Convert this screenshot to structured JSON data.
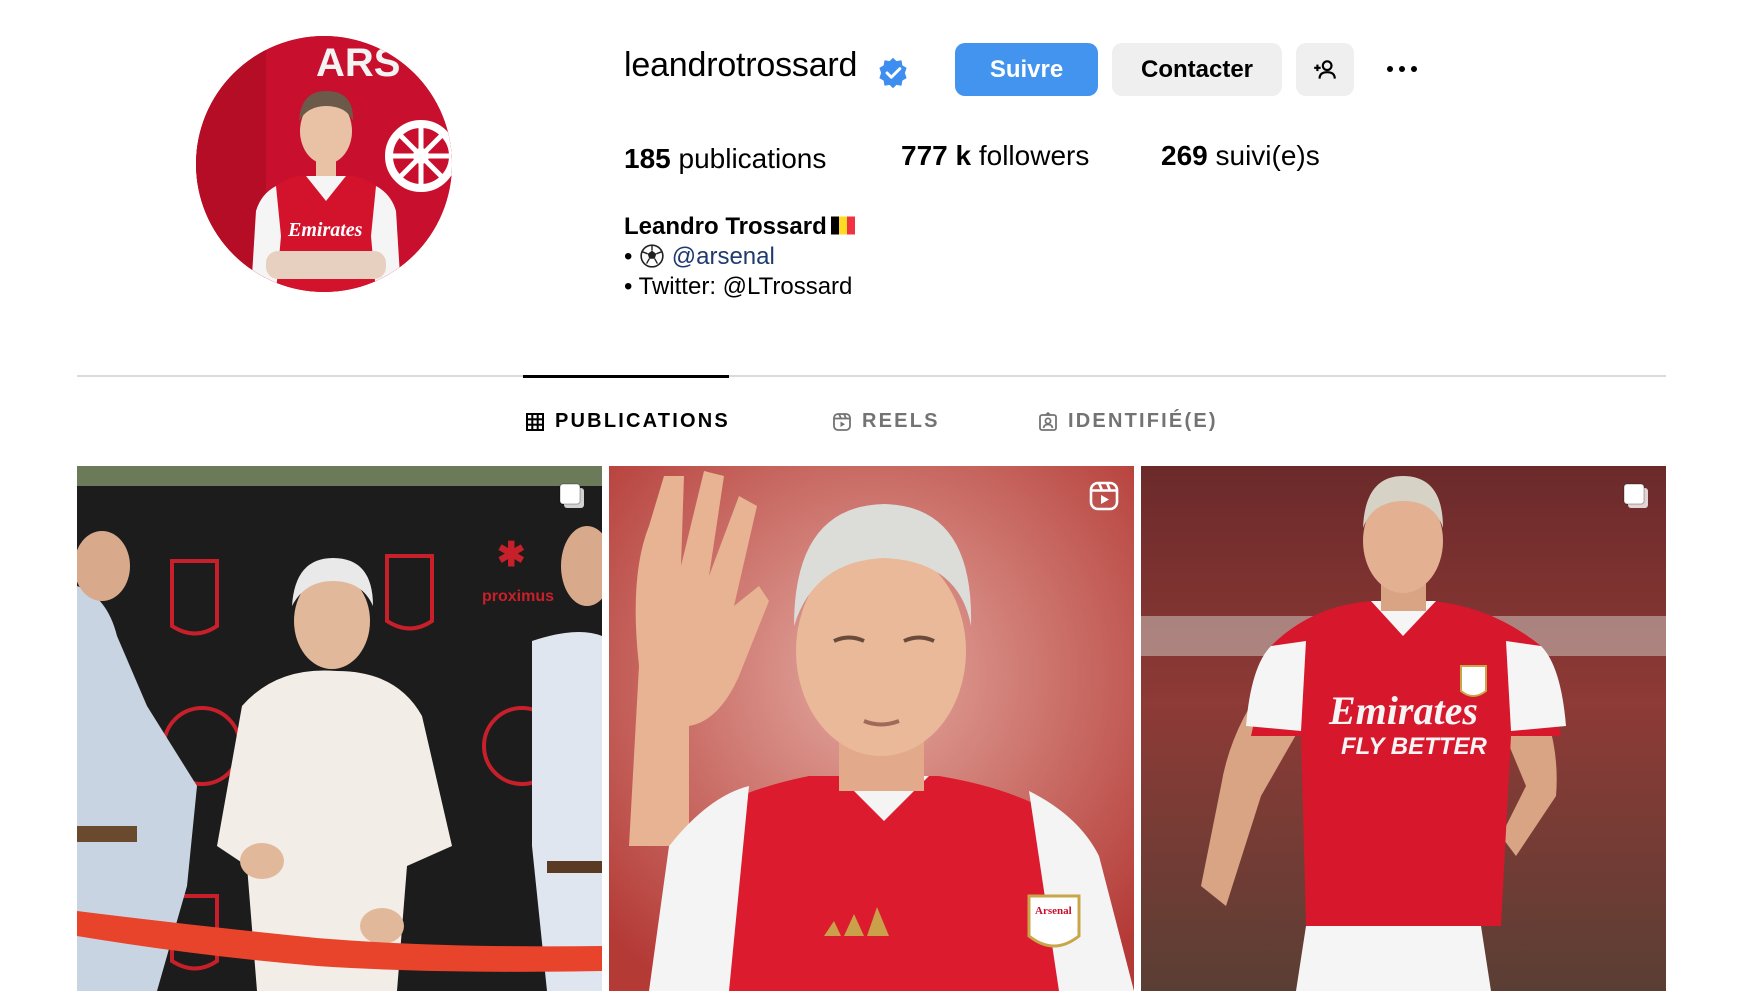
{
  "profile": {
    "username": "leandrotrossard",
    "verified": true,
    "buttons": {
      "follow": "Suivre",
      "contact": "Contacter"
    },
    "stats": {
      "posts_count": "185",
      "posts_label": "publications",
      "followers_count": "777 k",
      "followers_label": "followers",
      "following_count": "269",
      "following_label": "suivi(e)s"
    },
    "bio": {
      "full_name": "Leandro Trossard",
      "line1_bullet": "•",
      "line1_link": "@arsenal",
      "line2": "• Twitter: @LTrossard"
    }
  },
  "tabs": [
    {
      "label": "PUBLICATIONS",
      "icon": "grid-icon",
      "active": true
    },
    {
      "label": "REELS",
      "icon": "reels-icon",
      "active": false
    },
    {
      "label": "IDENTIFIÉ(E)",
      "icon": "tagged-icon",
      "active": false
    }
  ],
  "posts": [
    {
      "type": "carousel",
      "badge_icon": "carousel-icon",
      "alt": "Ribbon cutting ceremony"
    },
    {
      "type": "reel",
      "badge_icon": "reel-icon",
      "alt": "Player waving in Arsenal kit"
    },
    {
      "type": "carousel",
      "badge_icon": "carousel-icon",
      "alt": "Player running in Arsenal kit"
    }
  ],
  "colors": {
    "follow_button": "#4294ee",
    "secondary_button": "#efefef",
    "verified_badge": "#3e8ef1",
    "arsenal_red": "#c8102e",
    "link_color": "#1e3a6e"
  }
}
